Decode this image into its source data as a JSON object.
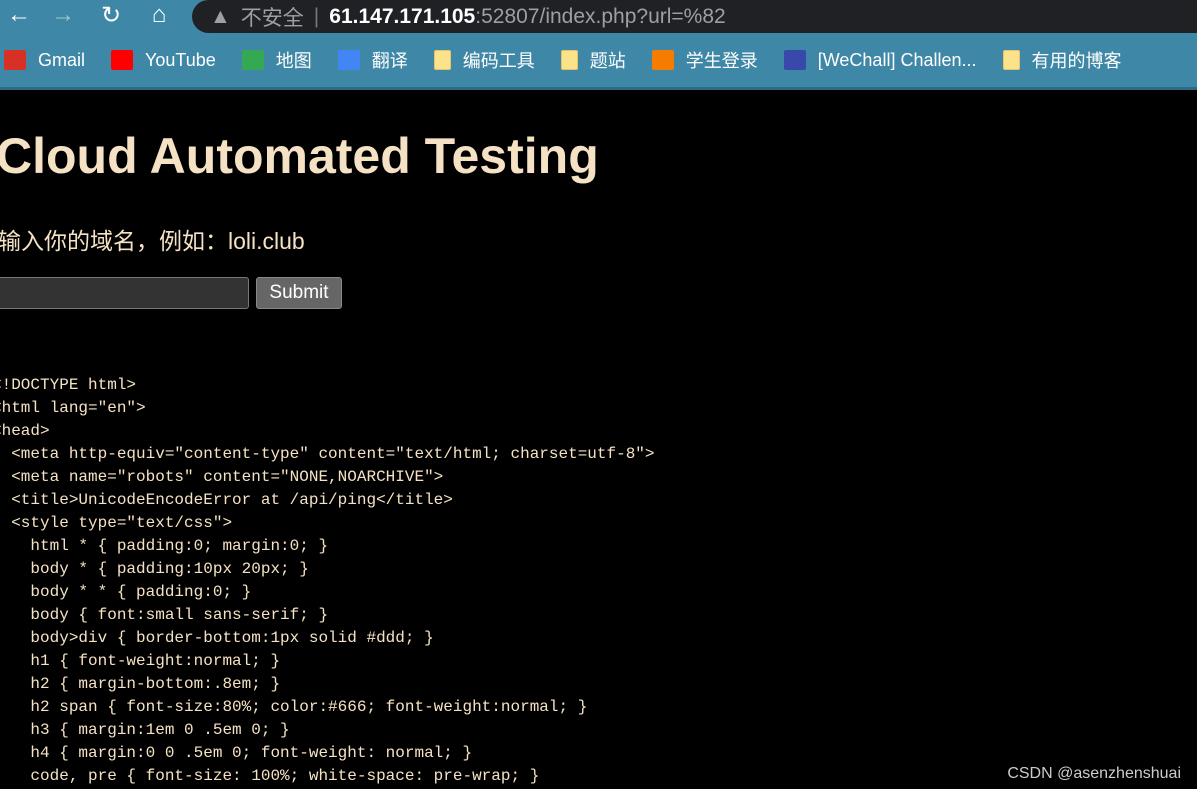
{
  "browser": {
    "security_label": "不安全",
    "url_host": "61.147.171.105",
    "url_rest": ":52807/index.php?url=%82",
    "bookmarks": [
      {
        "label": "Gmail",
        "icon": "gmail-icon",
        "color": "#d93025"
      },
      {
        "label": "YouTube",
        "icon": "youtube-icon",
        "color": "#ff0000"
      },
      {
        "label": "地图",
        "icon": "maps-icon",
        "color": "#34a853"
      },
      {
        "label": "翻译",
        "icon": "translate-icon",
        "color": "#4285f4"
      },
      {
        "label": "编码工具",
        "icon": "folder-icon"
      },
      {
        "label": "题站",
        "icon": "folder-icon"
      },
      {
        "label": "学生登录",
        "icon": "app-icon",
        "color": "#f57c00"
      },
      {
        "label": "[WeChall] Challen...",
        "icon": "wechall-icon",
        "color": "#3949ab"
      },
      {
        "label": "有用的博客",
        "icon": "folder-icon"
      }
    ]
  },
  "page": {
    "title": "Cloud Automated Testing",
    "prompt": "输入你的域名，例如：loli.club",
    "input_value": "",
    "submit_label": "Submit",
    "source": "<!DOCTYPE html>\n<html lang=\"en\">\n<head>\n  <meta http-equiv=\"content-type\" content=\"text/html; charset=utf-8\">\n  <meta name=\"robots\" content=\"NONE,NOARCHIVE\">\n  <title>UnicodeEncodeError at /api/ping</title>\n  <style type=\"text/css\">\n    html * { padding:0; margin:0; }\n    body * { padding:10px 20px; }\n    body * * { padding:0; }\n    body { font:small sans-serif; }\n    body>div { border-bottom:1px solid #ddd; }\n    h1 { font-weight:normal; }\n    h2 { margin-bottom:.8em; }\n    h2 span { font-size:80%; color:#666; font-weight:normal; }\n    h3 { margin:1em 0 .5em 0; }\n    h4 { margin:0 0 .5em 0; font-weight: normal; }\n    code, pre { font-size: 100%; white-space: pre-wrap; }"
  },
  "watermark": "CSDN @asenzhenshuai"
}
